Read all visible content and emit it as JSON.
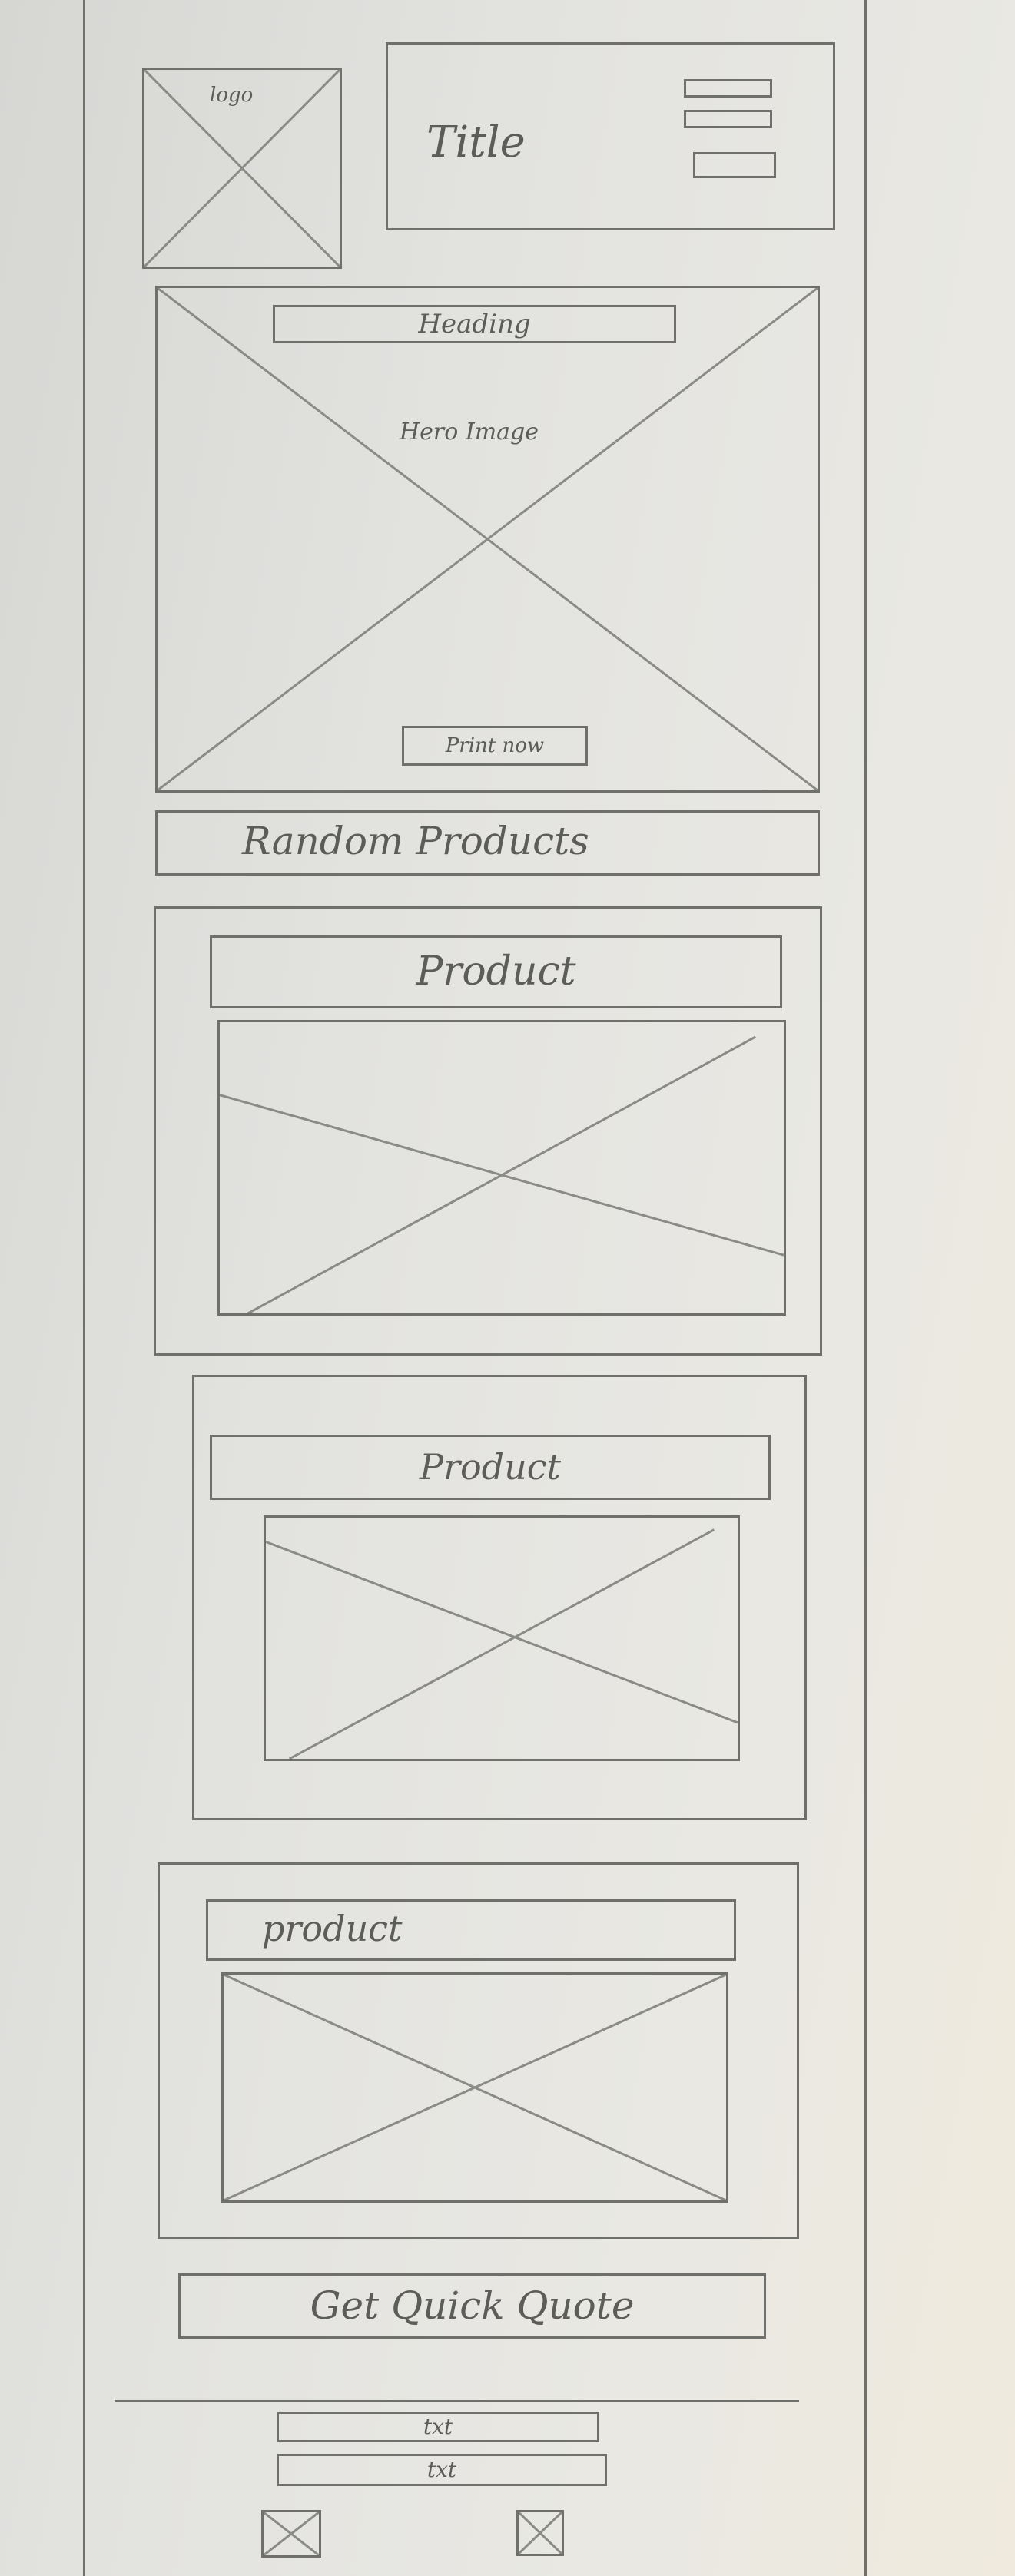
{
  "header": {
    "logo_label": "logo",
    "title": "Title",
    "menu_bars": 3
  },
  "hero": {
    "heading": "Heading",
    "image_label": "Hero Image",
    "button_label": "Print now"
  },
  "random_products": {
    "label": "Random Products"
  },
  "products": [
    {
      "label": "Product"
    },
    {
      "label": "Product"
    },
    {
      "label": "product"
    }
  ],
  "quote_button": {
    "label": "Get Quick Quote"
  },
  "footer": {
    "text_lines": [
      "txt",
      "txt"
    ]
  }
}
